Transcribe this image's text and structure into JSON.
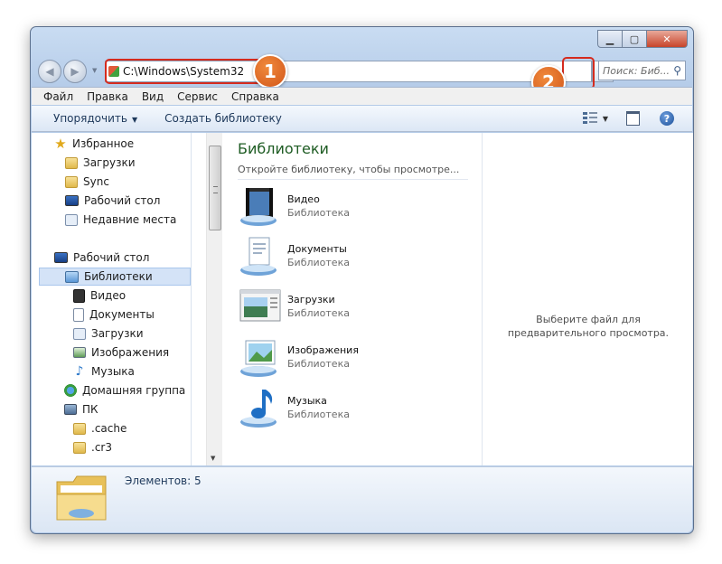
{
  "address": {
    "path": "C:\\Windows\\System32",
    "go_arrow": "→"
  },
  "search": {
    "placeholder": "Поиск: Биб...",
    "icon": "magnifier-icon"
  },
  "callouts": [
    "1",
    "2"
  ],
  "menu": [
    "Файл",
    "Правка",
    "Вид",
    "Сервис",
    "Справка"
  ],
  "toolbar": {
    "organize": "Упорядочить",
    "create_library": "Создать библиотеку"
  },
  "sidebar": [
    {
      "label": "Избранное",
      "icon": "star-icon"
    },
    {
      "label": "Загрузки",
      "icon": "folder-icon"
    },
    {
      "label": "Sync",
      "icon": "folder-icon"
    },
    {
      "label": "Рабочий стол",
      "icon": "desktop-icon"
    },
    {
      "label": "Недавние места",
      "icon": "recent-places-icon"
    },
    {
      "label": "Рабочий стол",
      "icon": "desktop-icon"
    },
    {
      "label": "Библиотеки",
      "icon": "libraries-icon",
      "selected": true
    },
    {
      "label": "Видео",
      "icon": "video-icon"
    },
    {
      "label": "Документы",
      "icon": "documents-icon"
    },
    {
      "label": "Загрузки",
      "icon": "downloads-icon"
    },
    {
      "label": "Изображения",
      "icon": "pictures-icon"
    },
    {
      "label": "Музыка",
      "icon": "music-icon"
    },
    {
      "label": "Домашняя группа",
      "icon": "homegroup-icon"
    },
    {
      "label": "ПК",
      "icon": "computer-icon"
    },
    {
      "label": ".cache",
      "icon": "folder-icon"
    },
    {
      "label": ".cr3",
      "icon": "folder-icon"
    }
  ],
  "libraries": {
    "title": "Библиотеки",
    "subtitle": "Откройте библиотеку, чтобы просмотре...",
    "items": [
      {
        "name": "Видео",
        "type": "Библиотека",
        "icon": "video-library-icon"
      },
      {
        "name": "Документы",
        "type": "Библиотека",
        "icon": "documents-library-icon"
      },
      {
        "name": "Загрузки",
        "type": "Библиотека",
        "icon": "downloads-library-icon"
      },
      {
        "name": "Изображения",
        "type": "Библиотека",
        "icon": "pictures-library-icon"
      },
      {
        "name": "Музыка",
        "type": "Библиотека",
        "icon": "music-library-icon"
      }
    ]
  },
  "preview": {
    "text": "Выберите файл для предварительного просмотра."
  },
  "details": {
    "count": "Элементов: 5"
  },
  "colors": {
    "accent_title": "#1e5c23",
    "callout": "#d52b1e",
    "badge": "#e0702a"
  }
}
